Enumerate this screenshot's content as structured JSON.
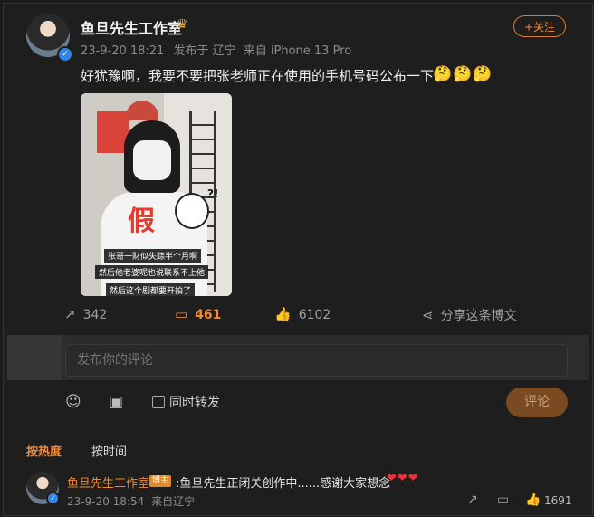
{
  "post": {
    "author": "鱼旦先生工作室",
    "crown_icon": "crown-icon",
    "timestamp": "23-9-20 18:21",
    "location": "发布于 辽宁",
    "source": "来自 iPhone 13 Pro",
    "follow_label": "+关注",
    "text": "好犹豫啊，我要不要把张老师正在使用的手机号码公布一下",
    "emojis": "🤔🤔🤔",
    "image": {
      "poster_text": "",
      "big_char": "假",
      "question_marks": "?!",
      "captions": [
        "张哥一财似失踪半个月啊",
        "然后他老婆呢也说联系不上他",
        "然后这个剧都要开拍了"
      ]
    },
    "stats": {
      "reposts": "342",
      "comments": "461",
      "likes": "6102",
      "share_label": "分享这条博文"
    }
  },
  "composer": {
    "placeholder": "发布你的评论",
    "repost_label": "同时转发",
    "submit_label": "评论"
  },
  "sort": {
    "hot": "按热度",
    "time": "按时间"
  },
  "comments": [
    {
      "author": "鱼旦先生工作室",
      "badge": "博主",
      "text": ":鱼旦先生正闭关创作中......感谢大家想念",
      "hearts": "❤❤❤",
      "timestamp": "23-9-20 18:54",
      "location": "来自辽宁",
      "likes": "1691"
    }
  ],
  "colors": {
    "accent": "#f08a36",
    "background": "#1e1e1e",
    "verified": "#2f86e8"
  }
}
